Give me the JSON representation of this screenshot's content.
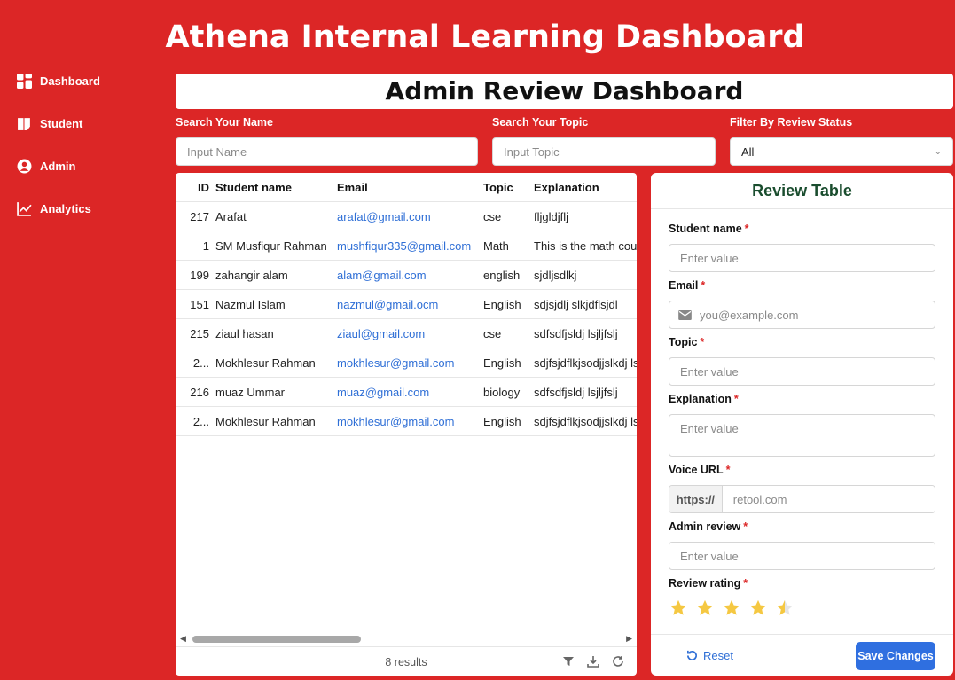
{
  "app": {
    "title": "Athena Internal Learning Dashboard"
  },
  "sidebar": {
    "items": [
      {
        "label": "Dashboard",
        "icon": "grid-icon"
      },
      {
        "label": "Student",
        "icon": "book-icon"
      },
      {
        "label": "Admin",
        "icon": "user-circle-icon"
      },
      {
        "label": "Analytics",
        "icon": "line-chart-icon"
      }
    ]
  },
  "main": {
    "title": "Admin Review Dashboard"
  },
  "filters": {
    "name": {
      "label": "Search Your Name",
      "placeholder": "Input Name"
    },
    "topic": {
      "label": "Search Your Topic",
      "placeholder": "Input Topic"
    },
    "status": {
      "label": "Filter By Review Status",
      "value": "All"
    }
  },
  "table": {
    "columns": [
      "ID",
      "Student name",
      "Email",
      "Topic",
      "Explanation"
    ],
    "rows": [
      [
        "217",
        "Arafat",
        "arafat@gmail.com",
        "cse",
        "fljgldjflj"
      ],
      [
        "1",
        "SM Musfiqur Rahman",
        "mushfiqur335@gmail.com",
        "Math",
        "This is the math cou"
      ],
      [
        "199",
        "zahangir alam",
        "alam@gmail.com",
        "english",
        "sjdljsdlkj"
      ],
      [
        "151",
        "Nazmul Islam",
        "nazmul@gmail.ocm",
        "English",
        "sdjsjdlj slkjdflsjdl"
      ],
      [
        "215",
        "ziaul hasan",
        "ziaul@gmail.com",
        "cse",
        "sdfsdfjsldj lsjljfslj"
      ],
      [
        "2...",
        "Mokhlesur Rahman",
        "mokhlesur@gmail.com",
        "English",
        "sdjfsjdflkjsodjjslkdj ls"
      ],
      [
        "216",
        "muaz Ummar",
        "muaz@gmail.com",
        "biology",
        "sdfsdfjsldj lsjljfslj"
      ],
      [
        "2...",
        "Mokhlesur Rahman",
        "mokhlesur@gmail.com",
        "English",
        "sdjfsjdflkjsodjjslkdj ls"
      ]
    ],
    "results_text": "8 results"
  },
  "form": {
    "title": "Review Table",
    "student_name": {
      "label": "Student name",
      "placeholder": "Enter value"
    },
    "email": {
      "label": "Email",
      "placeholder": "you@example.com"
    },
    "topic": {
      "label": "Topic",
      "placeholder": "Enter value"
    },
    "explanation": {
      "label": "Explanation",
      "placeholder": "Enter value"
    },
    "voice_url": {
      "label": "Voice URL",
      "prefix": "https://",
      "placeholder": "retool.com"
    },
    "admin_review": {
      "label": "Admin review",
      "placeholder": "Enter value"
    },
    "rating": {
      "label": "Review rating",
      "value": 4.5,
      "max": 5
    },
    "reset_label": "Reset",
    "save_label": "Save Changes",
    "required_mark": "*"
  },
  "colors": {
    "background": "#dc2626",
    "link": "#2f6fd6",
    "primary_button": "#2f6fe0",
    "form_title": "#1a4d2e",
    "star": "#f5c842"
  }
}
